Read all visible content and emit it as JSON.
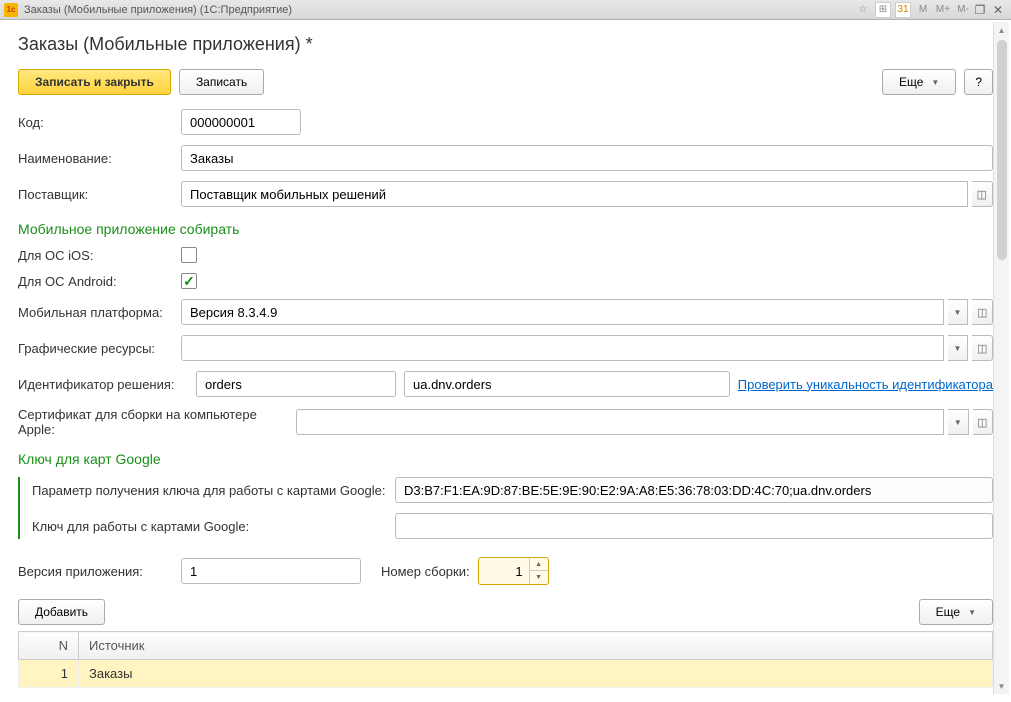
{
  "window": {
    "title": "Заказы (Мобильные приложения)  (1С:Предприятие)",
    "mbuttons": [
      "M",
      "M+",
      "M-"
    ]
  },
  "page": {
    "title": "Заказы (Мобильные приложения) *"
  },
  "toolbar": {
    "save_close": "Записать и закрыть",
    "save": "Записать",
    "more": "Еще",
    "help": "?"
  },
  "fields": {
    "code_label": "Код:",
    "code_value": "000000001",
    "name_label": "Наименование:",
    "name_value": "Заказы",
    "provider_label": "Поставщик:",
    "provider_value": "Поставщик мобильных решений"
  },
  "build_section": {
    "title": "Мобильное приложение собирать",
    "ios_label": "Для ОС iOS:",
    "ios_checked": false,
    "android_label": "Для ОС Android:",
    "android_checked": true,
    "platform_label": "Мобильная платформа:",
    "platform_value": "Версия 8.3.4.9",
    "graphics_label": "Графические ресурсы:",
    "graphics_value": "",
    "id_label": "Идентификатор решения:",
    "id_short": "orders",
    "id_full": "ua.dnv.orders",
    "check_link": "Проверить уникальность идентификатора",
    "cert_label": "Сертификат для сборки на компьютере Apple:",
    "cert_value": ""
  },
  "google_section": {
    "title": "Ключ для карт Google",
    "param_label": "Параметр получения ключа для работы с картами Google:",
    "param_value": "D3:B7:F1:EA:9D:87:BE:5E:9E:90:E2:9A:A8:E5:36:78:03:DD:4C:70;ua.dnv.orders",
    "key_label": "Ключ для работы с картами Google:",
    "key_value": ""
  },
  "version": {
    "app_label": "Версия приложения:",
    "app_value": "1",
    "build_label": "Номер сборки:",
    "build_value": "1"
  },
  "table": {
    "add": "Добавить",
    "more": "Еще",
    "col_n": "N",
    "col_source": "Источник",
    "rows": [
      {
        "n": "1",
        "source": "Заказы"
      }
    ]
  }
}
